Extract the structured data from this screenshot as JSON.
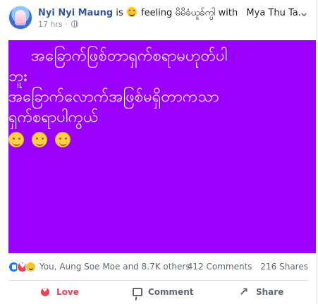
{
  "post": {
    "author": "Nyi Nyi Maung",
    "is_text": "is",
    "feeling_label": "feeling",
    "feeling_value": "မိမိခံယူခ်က္ပါ",
    "with_text": "with",
    "tagged_user": "Mya Thu Ta.",
    "timestamp": "17 hrs",
    "privacy_separator": "·",
    "more_options": "⌄",
    "image_text": {
      "line1": "အခြောက်ဖြစ်တာရှက်စရာမဟုတ်ပါ",
      "line2": "ဘူး",
      "line3": "အခြောက်လောက်အဖြစ်မရှိတာကသာ",
      "line4": "ရှက်စရာပါကွယ်"
    },
    "emoji_count": 3
  },
  "stats": {
    "reactions_text": "You, Aung Soe Moe and 8.7K others",
    "comments": "412 Comments",
    "shares": "216 Shares"
  },
  "actions": {
    "love": "Love",
    "comment": "Comment",
    "share": "Share"
  },
  "colors": {
    "post_background": "#9b00ff",
    "author_blue": "#365899",
    "love_red": "#f33e58"
  }
}
